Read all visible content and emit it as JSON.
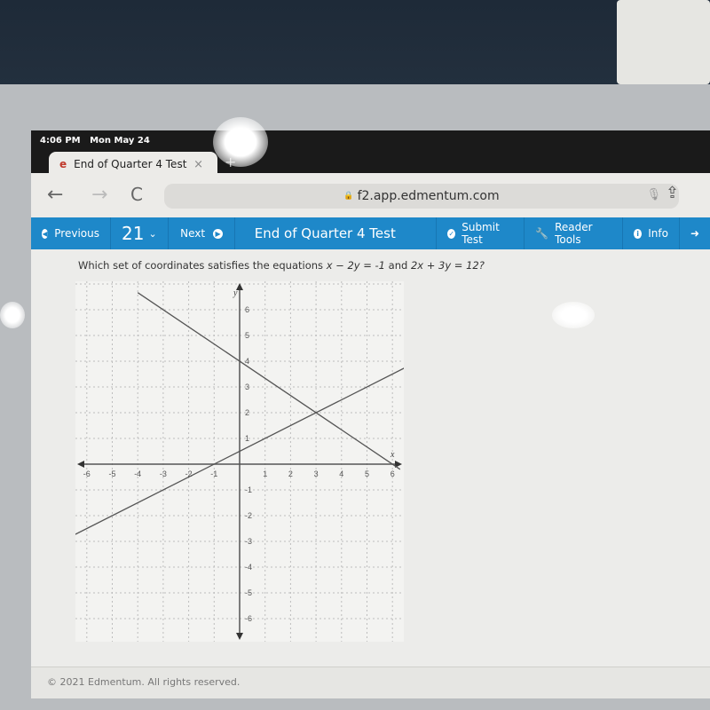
{
  "status_bar": {
    "time": "4:06 PM",
    "date": "Mon May 24"
  },
  "browser": {
    "tab_title": "End of Quarter 4 Test",
    "tab_close": "×",
    "new_tab": "+",
    "url": "f2.app.edmentum.com",
    "back": "←",
    "forward": "→",
    "reload": "C"
  },
  "app_bar": {
    "previous_label": "Previous",
    "question_number": "21",
    "next_label": "Next",
    "test_title": "End of Quarter 4 Test",
    "submit_label": "Submit Test",
    "reader_tools_label": "Reader Tools",
    "info_label": "Info",
    "accent_color": "#1e88c9"
  },
  "question": {
    "prefix": "Which set of coordinates satisfies the equations ",
    "eq1": "x − 2y = -1",
    "mid": " and ",
    "eq2": "2x + 3y = 12?"
  },
  "footer": {
    "copyright": "© 2021 Edmentum. All rights reserved."
  },
  "chart_data": {
    "type": "line",
    "title": "",
    "xlabel": "x",
    "ylabel": "y",
    "xlim": [
      -6.5,
      6.5
    ],
    "ylim": [
      -7,
      7
    ],
    "grid": true,
    "x_ticks": [
      -6,
      -5,
      -4,
      -3,
      -2,
      -1,
      1,
      2,
      3,
      4,
      5,
      6
    ],
    "y_ticks": [
      -6,
      -5,
      -4,
      -3,
      -2,
      -1,
      1,
      2,
      3,
      4,
      5,
      6
    ],
    "series": [
      {
        "name": "x - 2y = -1",
        "slope": 0.5,
        "intercept": 0.5,
        "points": [
          [
            -6.5,
            -2.75
          ],
          [
            6.5,
            3.75
          ]
        ]
      },
      {
        "name": "2x + 3y = 12",
        "slope": -0.6667,
        "intercept": 4,
        "points": [
          [
            -4,
            6.6667
          ],
          [
            6.3,
            -0.2
          ]
        ]
      }
    ],
    "intersection": [
      3,
      2
    ]
  }
}
